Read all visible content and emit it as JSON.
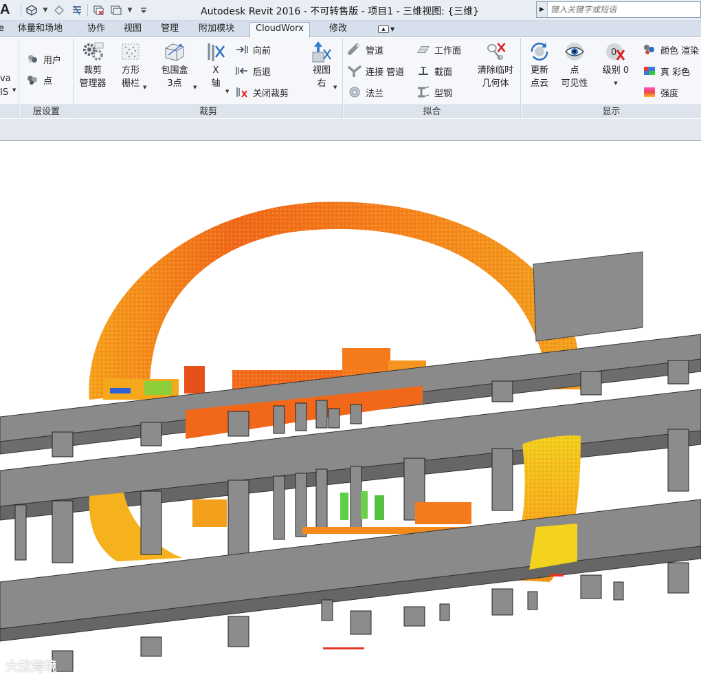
{
  "titlebar": {
    "logo": "A",
    "title": "Autodesk Revit 2016 - 不可转售版 -     项目1 - 三维视图: {三维}",
    "search_placeholder": "键入关键字或短语"
  },
  "tabs": [
    {
      "label": "体量和场地"
    },
    {
      "label": "协作"
    },
    {
      "label": "视图"
    },
    {
      "label": "管理"
    },
    {
      "label": "附加模块"
    },
    {
      "label": "CloudWorx",
      "active": true
    },
    {
      "label": "修改"
    }
  ],
  "ribbon": {
    "partial_left": {
      "line1": "va",
      "line2": "IS"
    },
    "layers": {
      "label": "层设置",
      "items": [
        "用户",
        "点"
      ]
    },
    "crop": {
      "label": "裁剪",
      "manager": {
        "line1": "裁剪",
        "line2": "管理器"
      },
      "square_fence": {
        "line1": "方形",
        "line2": "栅栏"
      },
      "bounding_box": {
        "line1": "包围盒",
        "line2": "3点"
      },
      "x_axis": {
        "line1": "X",
        "line2": "轴"
      },
      "forward": "向前",
      "back": "后退",
      "close_crop": "关闭裁剪",
      "view_right": {
        "line1": "视图",
        "line2": "右"
      }
    },
    "fit": {
      "label": "拟合",
      "pipe": "管道",
      "connect_pipe": "连接 管道",
      "flange": "法兰",
      "work_plane": "工作面",
      "section": "截面",
      "steel": "型钢",
      "clear_temp": {
        "line1": "清除临时",
        "line2": "几何体"
      }
    },
    "display": {
      "label": "显示",
      "update_cloud": {
        "line1": "更新",
        "line2": "点云"
      },
      "point_visibility": {
        "line1": "点",
        "line2": "可见性"
      },
      "level": {
        "line1": "级别 0"
      },
      "color_render": "颜色 渲染",
      "true_color": "真 彩色",
      "intensity": "强度"
    }
  },
  "viewport": {
    "watermark": "大數跨境"
  },
  "colors": {
    "accent": "#f26a1b",
    "structure_gray": "#8a8a8a"
  }
}
